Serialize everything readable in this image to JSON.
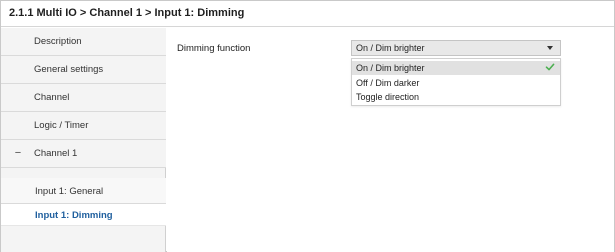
{
  "header": {
    "breadcrumb": "2.1.1 Multi IO > Channel 1 > Input 1: Dimming"
  },
  "sidebar": {
    "items": [
      {
        "label": "Description"
      },
      {
        "label": "General settings"
      },
      {
        "label": "Channel"
      },
      {
        "label": "Logic / Timer"
      },
      {
        "label": "Channel 1",
        "expanded_icon": "minus-collapse-icon"
      },
      {
        "label": "Input 1: General"
      },
      {
        "label": "Input 1: Dimming",
        "active": true
      }
    ]
  },
  "main": {
    "parameter": {
      "label": "Dimming function",
      "selected_value": "On / Dim brighter",
      "options": [
        {
          "label": "On / Dim brighter",
          "selected": true,
          "icon": "checkmark-icon"
        },
        {
          "label": "Off / Dim darker"
        },
        {
          "label": "Toggle direction"
        }
      ]
    }
  },
  "colors": {
    "active_nav_text": "#1f5f9e",
    "check_green": "#4caf50",
    "select_bg": "#e8e8e8",
    "sidebar_bg": "#f4f4f4"
  }
}
